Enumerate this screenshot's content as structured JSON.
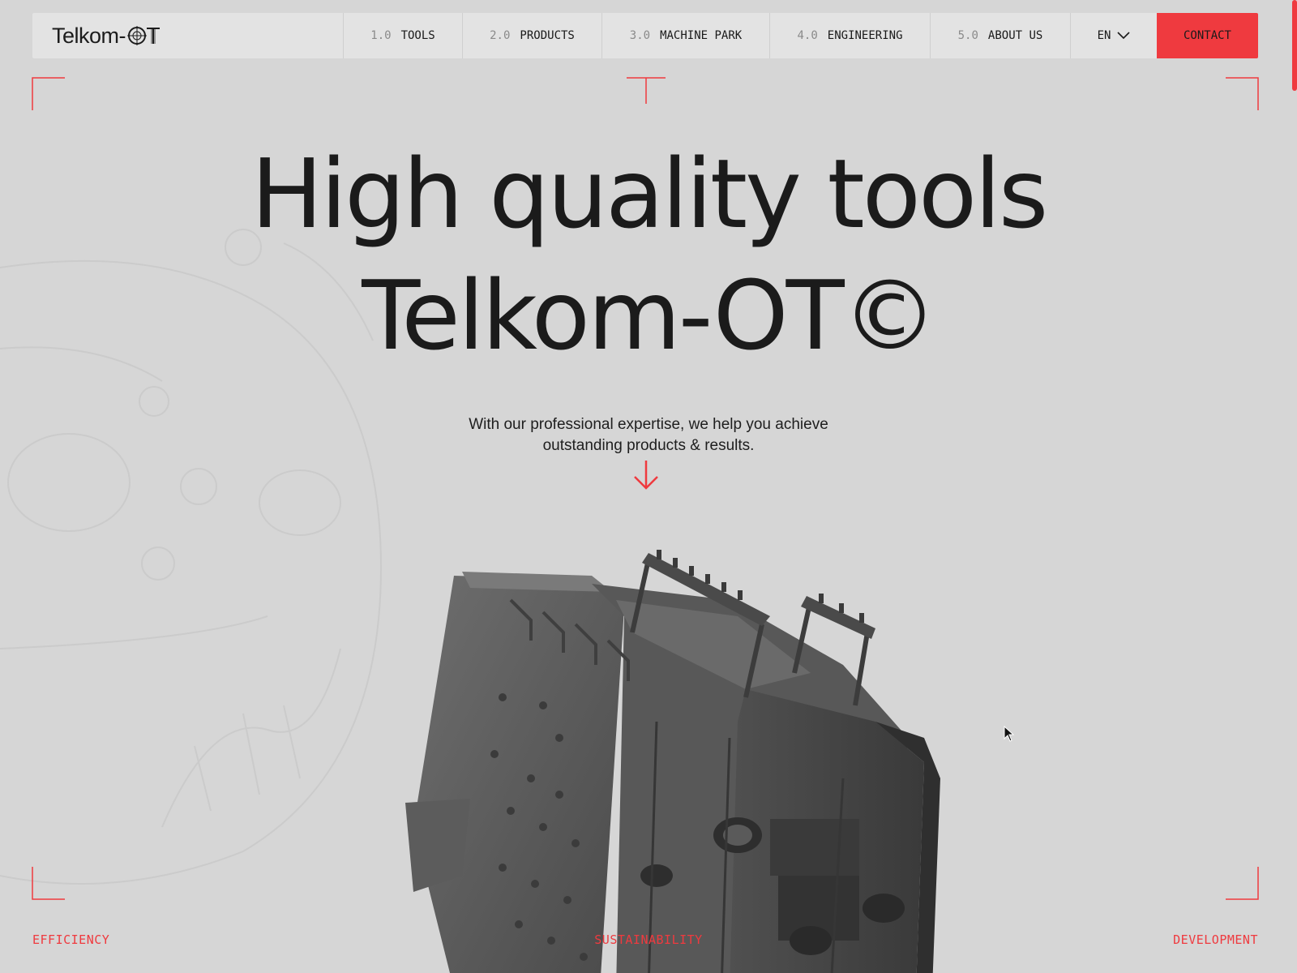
{
  "nav": {
    "logo_text": "Telkom-",
    "items": [
      {
        "num": "1.0",
        "label": "TOOLS"
      },
      {
        "num": "2.0",
        "label": "PRODUCTS"
      },
      {
        "num": "3.0",
        "label": "MACHINE PARK"
      },
      {
        "num": "4.0",
        "label": "ENGINEERING"
      },
      {
        "num": "5.0",
        "label": "ABOUT US"
      }
    ],
    "language": "EN",
    "contact_label": "CONTACT"
  },
  "hero": {
    "title_line1": "High quality tools",
    "title_line2": "Telkom-OT©",
    "subtitle": "With our professional expertise, we help you achieve outstanding products & results.",
    "scroll_icon": "arrow-down-icon"
  },
  "footer_labels": {
    "left": "EFFICIENCY",
    "center": "SUSTAINABILITY",
    "right": "DEVELOPMENT"
  },
  "colors": {
    "accent": "#ef3a3f",
    "background": "#d6d6d6",
    "nav_background": "#e3e3e3",
    "text": "#1a1a1a"
  }
}
